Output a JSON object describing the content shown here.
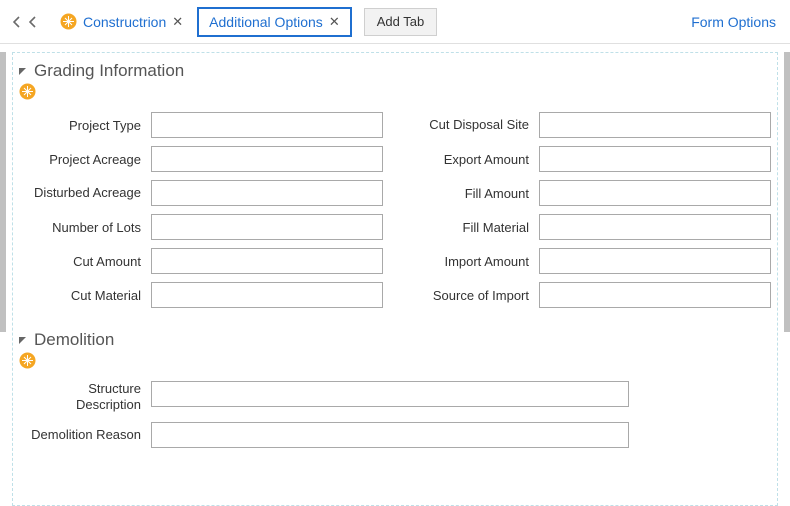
{
  "tabbar": {
    "tab1_label": "Constructrion",
    "tab2_label": "Additional Options",
    "add_tab_label": "Add Tab",
    "form_options_label": "Form Options"
  },
  "sections": {
    "grading": {
      "title": "Grading Information",
      "left": [
        {
          "label": "Project Type",
          "value": ""
        },
        {
          "label": "Project Acreage",
          "value": ""
        },
        {
          "label": "Disturbed Acreage",
          "value": ""
        },
        {
          "label": "Number of Lots",
          "value": ""
        },
        {
          "label": "Cut Amount",
          "value": ""
        },
        {
          "label": "Cut Material",
          "value": ""
        }
      ],
      "right": [
        {
          "label": "Cut Disposal Site",
          "value": ""
        },
        {
          "label": "Export Amount",
          "value": ""
        },
        {
          "label": "Fill Amount",
          "value": ""
        },
        {
          "label": "Fill Material",
          "value": ""
        },
        {
          "label": "Import Amount",
          "value": ""
        },
        {
          "label": "Source of Import",
          "value": ""
        }
      ]
    },
    "demolition": {
      "title": "Demolition",
      "fields": [
        {
          "label": "Structure Description",
          "value": ""
        },
        {
          "label": "Demolition Reason",
          "value": ""
        }
      ]
    }
  }
}
